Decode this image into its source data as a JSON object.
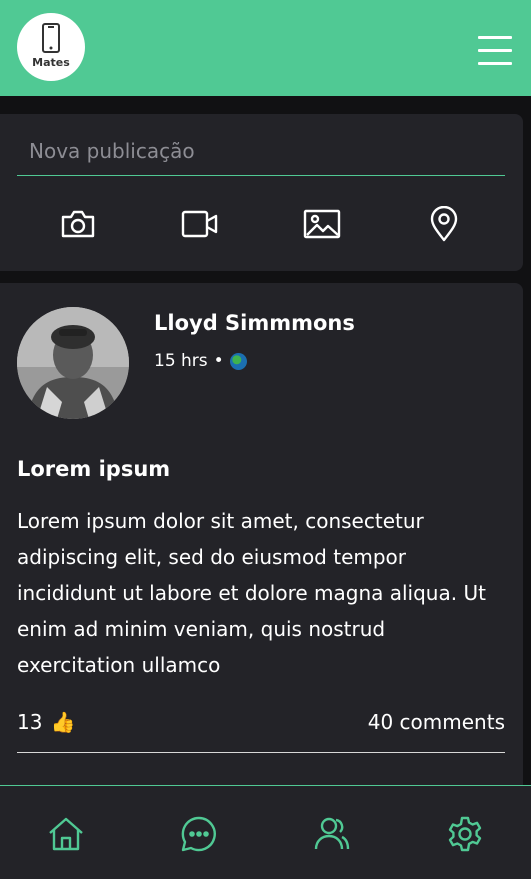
{
  "header": {
    "logo_text": "Mates",
    "menu_icon": "hamburger-menu-icon"
  },
  "composer": {
    "placeholder": "Nova publicação",
    "actions": [
      {
        "name": "camera-icon",
        "label": "Camera"
      },
      {
        "name": "video-icon",
        "label": "Video"
      },
      {
        "name": "image-icon",
        "label": "Image"
      },
      {
        "name": "location-pin-icon",
        "label": "Location"
      }
    ]
  },
  "post": {
    "author": "Lloyd Simmmons",
    "time": "15 hrs",
    "separator": "•",
    "privacy_icon": "globe-icon",
    "title": "Lorem ipsum",
    "body": "Lorem ipsum dolor sit amet, consectetur adipiscing elit, sed do eiusmod tempor incididunt ut labore et dolore magna aliqua. Ut enim ad minim veniam, quis nostrud exercitation ullamco",
    "likes": "13",
    "like_emoji": "👍",
    "comments": "40 comments"
  },
  "bottom_nav": [
    {
      "name": "home-icon"
    },
    {
      "name": "chat-icon"
    },
    {
      "name": "friends-icon"
    },
    {
      "name": "settings-icon"
    }
  ],
  "colors": {
    "accent": "#50c994",
    "card": "#232328",
    "background": "#111113"
  }
}
